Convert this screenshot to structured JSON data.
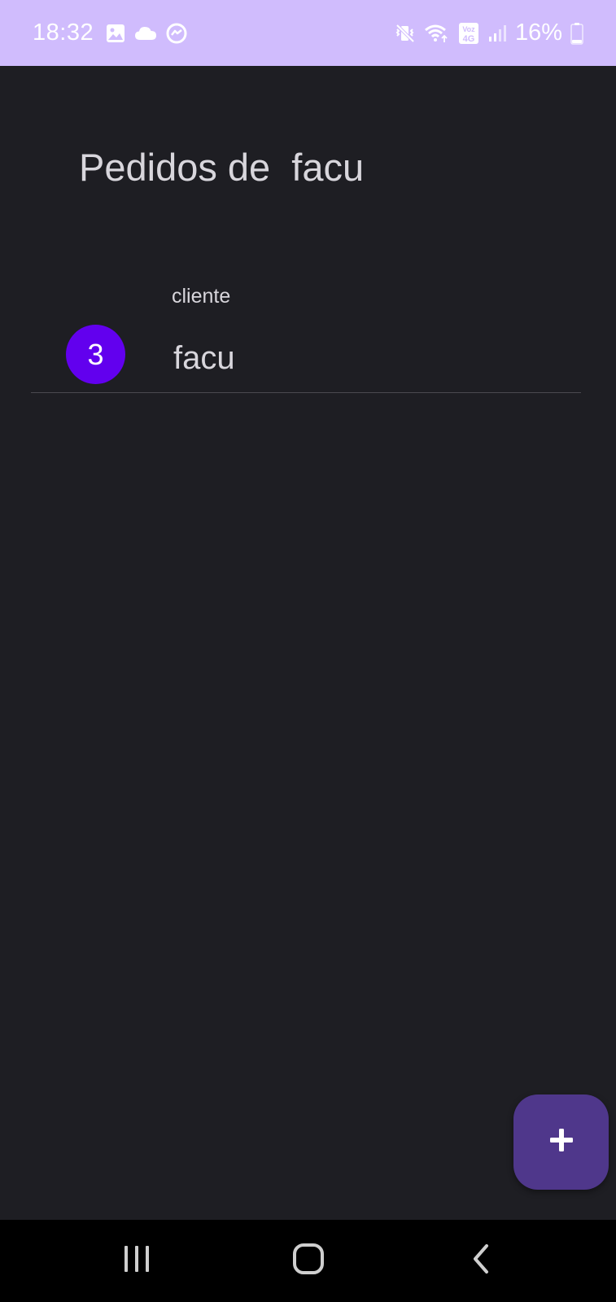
{
  "status_bar": {
    "time": "18:32",
    "battery_percent": "16%",
    "network_label": "Voz 4G",
    "icons_left": [
      "gallery-icon",
      "cloud-icon",
      "messenger-icon"
    ],
    "icons_right": [
      "vibrate-mute-icon",
      "wifi-icon",
      "volte-4g-icon",
      "signal-icon",
      "battery-icon"
    ],
    "background_color": "#d0bcfd"
  },
  "page": {
    "title": "Pedidos de  facu"
  },
  "orders": [
    {
      "count": "3",
      "caption": "cliente",
      "name": "facu",
      "badge_color": "#6200ee"
    }
  ],
  "fab": {
    "icon": "plus-icon",
    "color": "#4f378b"
  },
  "nav_bar": {
    "buttons": [
      "recent-apps-icon",
      "home-icon",
      "back-icon"
    ]
  }
}
